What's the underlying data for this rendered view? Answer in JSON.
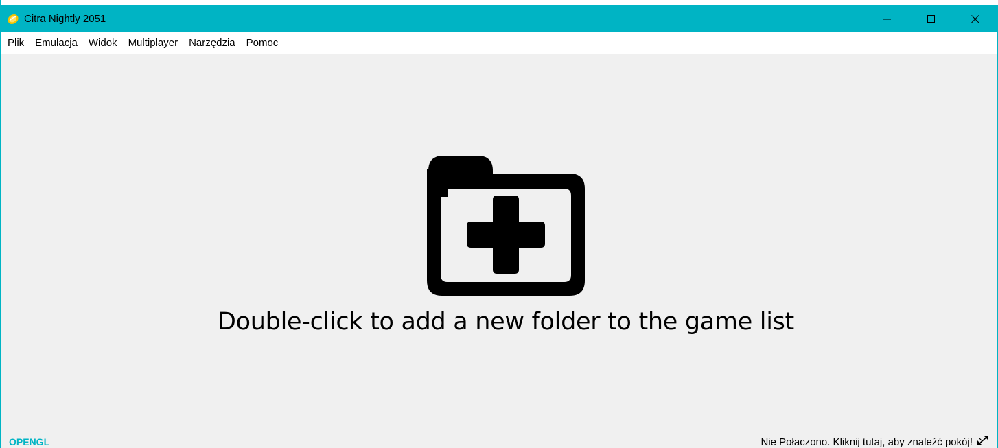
{
  "window": {
    "title": "Citra Nightly 2051",
    "icon": "citra-app-icon",
    "controls": {
      "minimize_icon": "minimize-icon",
      "maximize_icon": "maximize-icon",
      "close_icon": "close-icon"
    }
  },
  "menubar": {
    "items": [
      {
        "label": "Plik"
      },
      {
        "label": "Emulacja"
      },
      {
        "label": "Widok"
      },
      {
        "label": "Multiplayer"
      },
      {
        "label": "Narzędzia"
      },
      {
        "label": "Pomoc"
      }
    ]
  },
  "game_list": {
    "icon": "folder-plus-icon",
    "hint": "Double-click to add a new folder to the game list"
  },
  "statusbar": {
    "renderer": "OPENGL",
    "network_status": "Nie Połaczono. Kliknij tutaj, aby znaleźć pokój!",
    "network_icon": "network-disconnected-icon"
  },
  "colors": {
    "accent": "#00b4c4",
    "background": "#f0f0f0"
  }
}
